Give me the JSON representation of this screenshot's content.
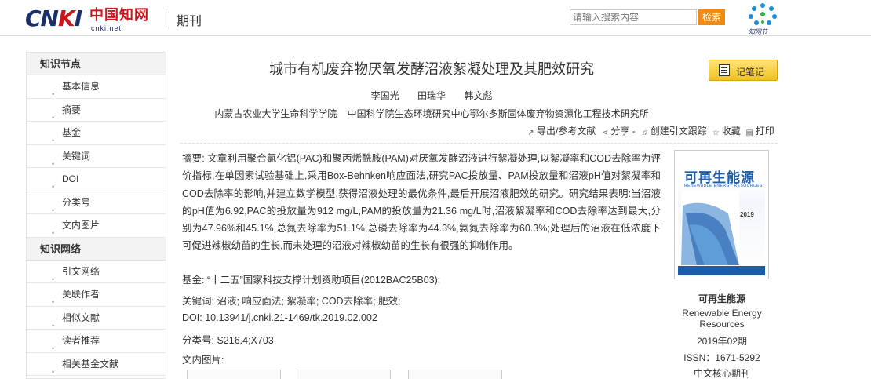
{
  "header": {
    "logo_text": "CNKI",
    "logo_cn": "中国知网",
    "logo_url": "cnki.net",
    "section_title": "期刊",
    "search_placeholder": "请输入搜索内容",
    "search_button": "检索",
    "zhiwang_label": "知网节"
  },
  "sidebar": {
    "section1": "知识节点",
    "items1": [
      "基本信息",
      "摘要",
      "基金",
      "关键词",
      "DOI",
      "分类号",
      "文内图片"
    ],
    "section2": "知识网络",
    "items2": [
      "引文网络",
      "关联作者",
      "相似文献",
      "读者推荐",
      "相关基金文献"
    ]
  },
  "article": {
    "title": "城市有机废弃物厌氧发酵沼液絮凝处理及其肥效研究",
    "note_button": "记笔记",
    "authors": [
      "李国光",
      "田瑞华",
      "韩文彪"
    ],
    "orgs": [
      "内蒙古农业大学生命科学学院",
      "中国科学院生态环境研究中心鄂尔多斯固体废弃物资源化工程技术研究所"
    ],
    "toolbar": {
      "export": "导出/参考文献",
      "share": "分享",
      "track": "创建引文跟踪",
      "favorite": "收藏",
      "print": "打印"
    },
    "abstract_label": "摘要:",
    "abstract": "文章利用聚合氯化铝(PAC)和聚丙烯酰胺(PAM)对厌氧发酵沼液进行絮凝处理,以絮凝率和COD去除率为评价指标,在单因素试验基础上,采用Box-Behnken响应面法,研究PAC投放量、PAM投放量和沼液pH值对絮凝率和COD去除率的影响,并建立数学模型,获得沼液处理的最优条件,最后开展沼液肥效的研究。研究结果表明:当沼液的pH值为6.92,PAC的投放量为912 mg/L,PAM的投放量为21.36 mg/L时,沼液絮凝率和COD去除率达到最大,分别为47.96%和45.1%,总氮去除率为51.1%,总磷去除率为44.3%,氨氮去除率为60.3%;处理后的沼液在低浓度下可促进辣椒幼苗的生长,而未处理的沼液对辣椒幼苗的生长有很强的抑制作用。",
    "fund_label": "基金:",
    "fund": "“十二五”国家科技支撑计划资助项目(2012BAC25B03);",
    "keywords_label": "关键词:",
    "keywords": "沼液; 响应面法; 絮凝率; COD去除率; 肥效;",
    "doi_label": "DOI:",
    "doi": "10.13941/j.cnki.21-1469/tk.2019.02.002",
    "class_label": "分类号:",
    "class": "S216.4;X703",
    "figures_label": "文内图片:"
  },
  "journal": {
    "cover_title": "可再生能源",
    "cover_subtitle": "RENEWABLE ENERGY RESOURCES",
    "cover_year": "2019",
    "name": "可再生能源",
    "name_en": "Renewable Energy Resources",
    "issue": "2019年02期",
    "issn": "ISSN：1671-5292",
    "core": "中文核心期刊"
  },
  "colors": {
    "brand_blue": "#1a2f6b",
    "brand_red": "#c8161d",
    "search_orange": "#f08a14",
    "note_yellow": "#f2c21a",
    "cover_blue": "#1c5cab"
  }
}
